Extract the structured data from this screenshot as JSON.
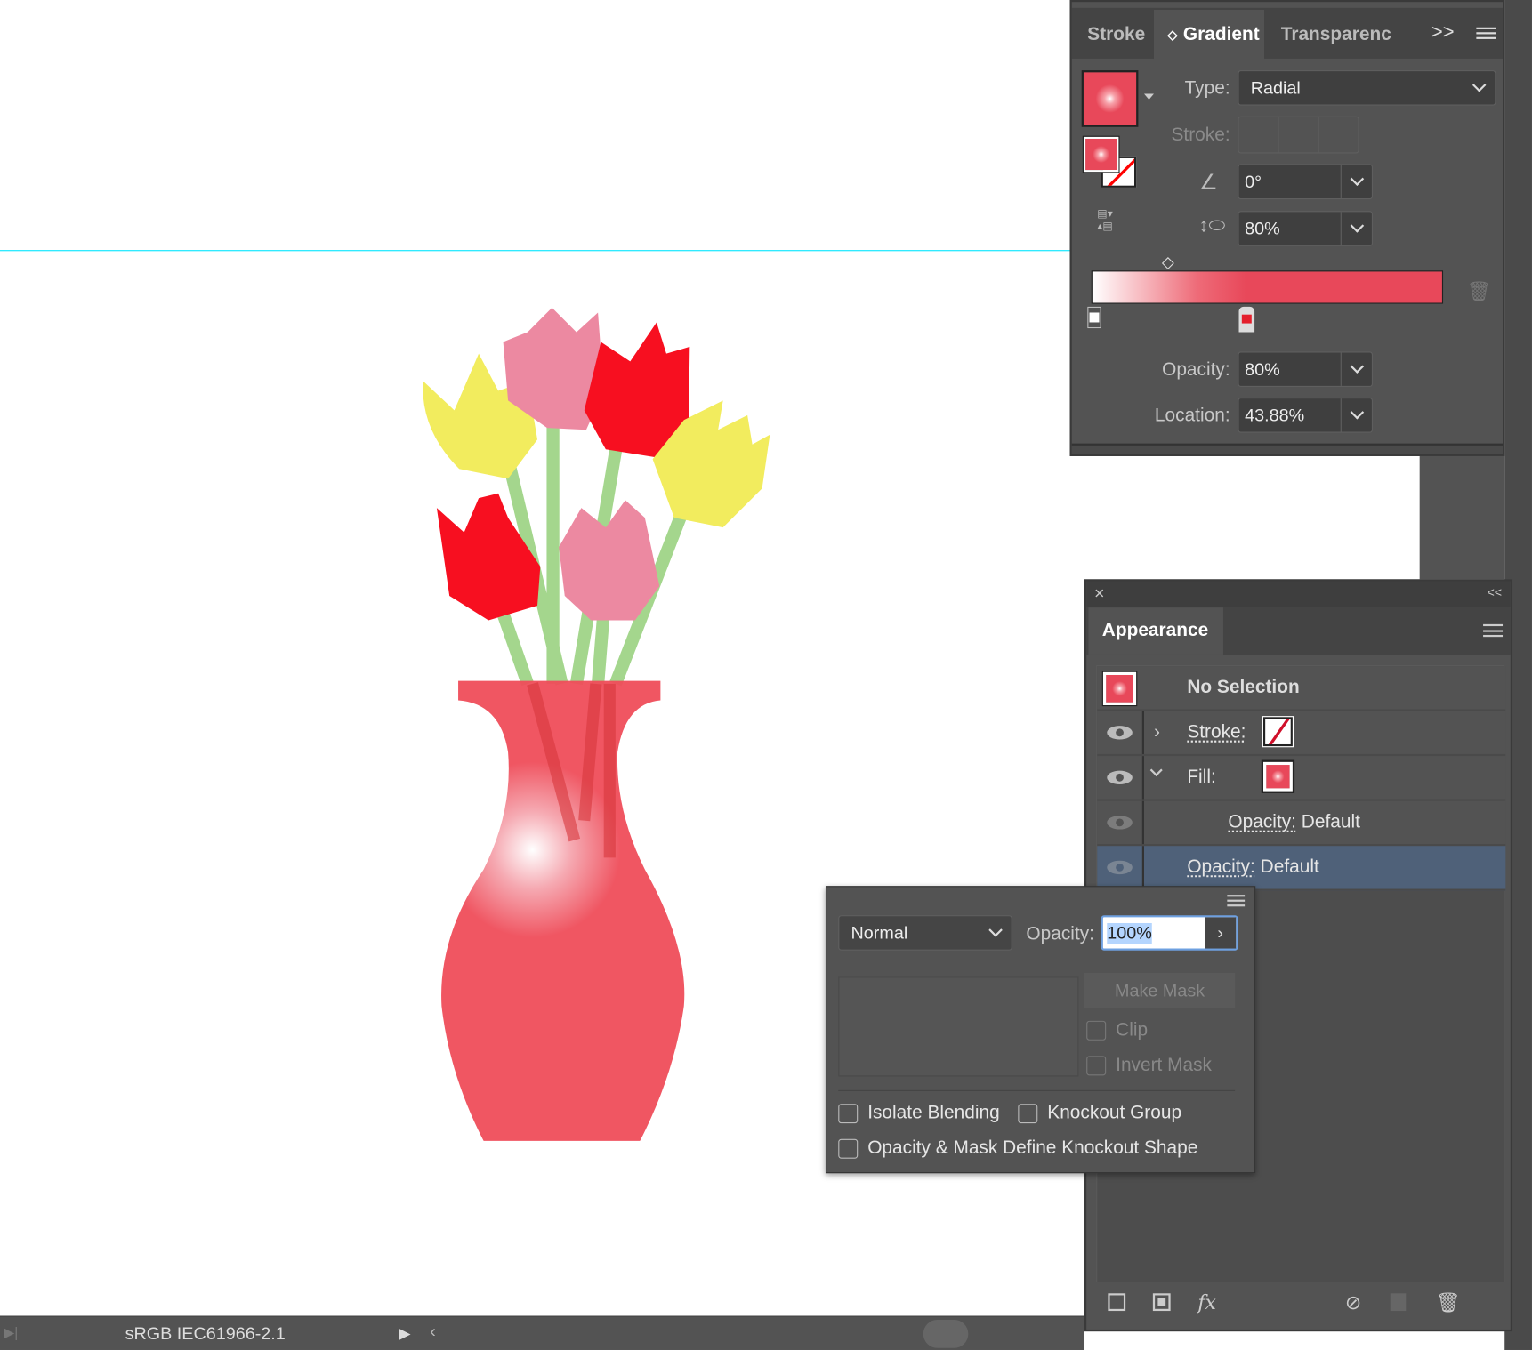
{
  "gradient_panel": {
    "tabs": [
      {
        "label": "Stroke"
      },
      {
        "label": "Gradient",
        "active": true
      },
      {
        "label": "Transparenc"
      }
    ],
    "type_label": "Type:",
    "type_value": "Radial",
    "stroke_label": "Stroke:",
    "angle_value": "0°",
    "aspect_value": "80%",
    "opacity_label": "Opacity:",
    "opacity_value": "80%",
    "location_label": "Location:",
    "location_value": "43.88%",
    "gradient_colors": [
      "#ffffff",
      "#e8485a"
    ]
  },
  "appearance_panel": {
    "title": "Appearance",
    "rows": [
      {
        "label": "No Selection"
      },
      {
        "label": "Stroke:"
      },
      {
        "label": "Fill:"
      },
      {
        "label": "Opacity:",
        "value": "Default"
      },
      {
        "label": "Opacity:",
        "value": "Default",
        "selected": true
      }
    ]
  },
  "transparency_popup": {
    "blend_mode": "Normal",
    "opacity_label": "Opacity:",
    "opacity_value": "100%",
    "make_mask": "Make Mask",
    "clip": "Clip",
    "invert_mask": "Invert Mask",
    "isolate_blending": "Isolate Blending",
    "knockout_group": "Knockout Group",
    "opacity_mask_knockout": "Opacity & Mask Define Knockout Shape"
  },
  "status_bar": {
    "color_profile": "sRGB IEC61966-2.1"
  },
  "colors": {
    "accent_red": "#e8485a",
    "selection": "#4a5e78",
    "guide": "#00e5ff",
    "panel": "#535353"
  }
}
